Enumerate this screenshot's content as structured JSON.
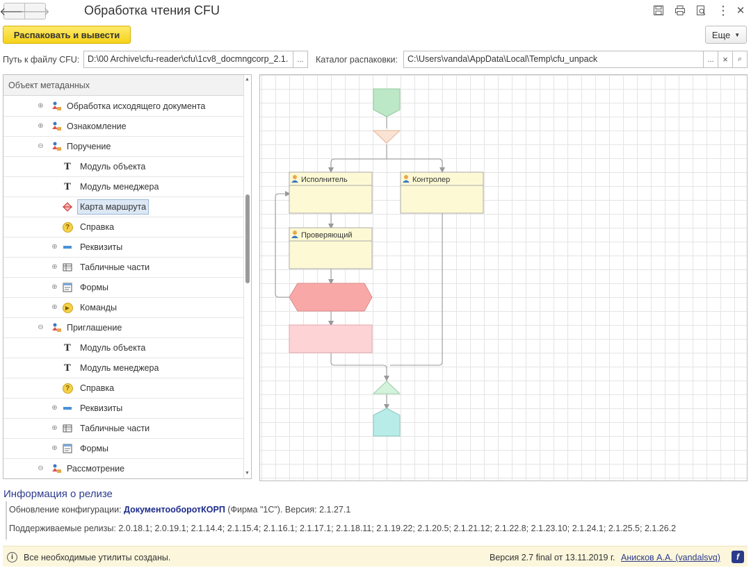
{
  "window": {
    "title": "Обработка чтения CFU"
  },
  "toolbar": {
    "primary_label": "Распаковать и вывести",
    "more_label": "Еще"
  },
  "fields": {
    "cfu_path_label": "Путь к файлу CFU:",
    "cfu_path_value": "D:\\00 Archive\\cfu-reader\\cfu\\1cv8_docmngcorp_2.1.",
    "unpack_dir_label": "Каталог распаковки:",
    "unpack_dir_value": "C:\\Users\\vanda\\AppData\\Local\\Temp\\cfu_unpack",
    "browse_label": "...",
    "clear_label": "×"
  },
  "tree": {
    "header": "Объект метаданных",
    "rows": [
      {
        "label": "Обработка исходящего документа",
        "icon": "business-process-icon",
        "level": 1,
        "expander": "⊕"
      },
      {
        "label": "Ознакомление",
        "icon": "business-process-icon",
        "level": 1,
        "expander": "⊕"
      },
      {
        "label": "Поручение",
        "icon": "business-process-icon",
        "level": 1,
        "expander": "⊖"
      },
      {
        "label": "Модуль объекта",
        "icon": "module-icon",
        "level": 2,
        "expander": ""
      },
      {
        "label": "Модуль менеджера",
        "icon": "module-icon",
        "level": 2,
        "expander": ""
      },
      {
        "label": "Карта маршрута",
        "icon": "route-map-icon",
        "level": 2,
        "expander": "",
        "selected": true
      },
      {
        "label": "Справка",
        "icon": "help-icon",
        "level": 2,
        "expander": ""
      },
      {
        "label": "Реквизиты",
        "icon": "attributes-icon",
        "level": 2,
        "expander": "⊕"
      },
      {
        "label": "Табличные части",
        "icon": "table-icon",
        "level": 2,
        "expander": "⊕"
      },
      {
        "label": "Формы",
        "icon": "form-icon",
        "level": 2,
        "expander": "⊕"
      },
      {
        "label": "Команды",
        "icon": "command-icon",
        "level": 2,
        "expander": "⊕"
      },
      {
        "label": "Приглашение",
        "icon": "business-process-icon",
        "level": 1,
        "expander": "⊖"
      },
      {
        "label": "Модуль объекта",
        "icon": "module-icon",
        "level": 2,
        "expander": ""
      },
      {
        "label": "Модуль менеджера",
        "icon": "module-icon",
        "level": 2,
        "expander": ""
      },
      {
        "label": "Справка",
        "icon": "help-icon",
        "level": 2,
        "expander": ""
      },
      {
        "label": "Реквизиты",
        "icon": "attributes-icon",
        "level": 2,
        "expander": "⊕"
      },
      {
        "label": "Табличные части",
        "icon": "table-icon",
        "level": 2,
        "expander": "⊕"
      },
      {
        "label": "Формы",
        "icon": "form-icon",
        "level": 2,
        "expander": "⊕"
      },
      {
        "label": "Рассмотрение",
        "icon": "business-process-icon",
        "level": 1,
        "expander": "⊖"
      }
    ]
  },
  "diagram": {
    "nodes": {
      "performer": "Исполнитель",
      "controller": "Контролер",
      "checker": "Проверяющий"
    },
    "colors": {
      "start": "#bde8c8",
      "split": "#fbe3d3",
      "role_fill": "#fdf9d4",
      "condition": "#f9a8a8",
      "action": "#fdd3d6",
      "join": "#d4f3dc",
      "end": "#b8ece8"
    }
  },
  "release": {
    "title": "Информация о релизе",
    "update_prefix": "Обновление конфигурации: ",
    "config_name": "ДокументооборотКОРП",
    "update_suffix": " (Фирма \"1С\"). Версия: 2.1.27.1",
    "supported": "Поддерживаемые релизы: 2.0.18.1; 2.0.19.1; 2.1.14.4; 2.1.15.4; 2.1.16.1; 2.1.17.1; 2.1.18.11; 2.1.19.22; 2.1.20.5; 2.1.21.12; 2.1.22.8; 2.1.23.10; 2.1.24.1; 2.1.25.5; 2.1.26.2"
  },
  "status": {
    "message": "Все необходимые утилиты созданы.",
    "version": "Версия 2.7 final от 13.11.2019 г.",
    "author": "Анисков А.А. (vandalsvq)"
  }
}
